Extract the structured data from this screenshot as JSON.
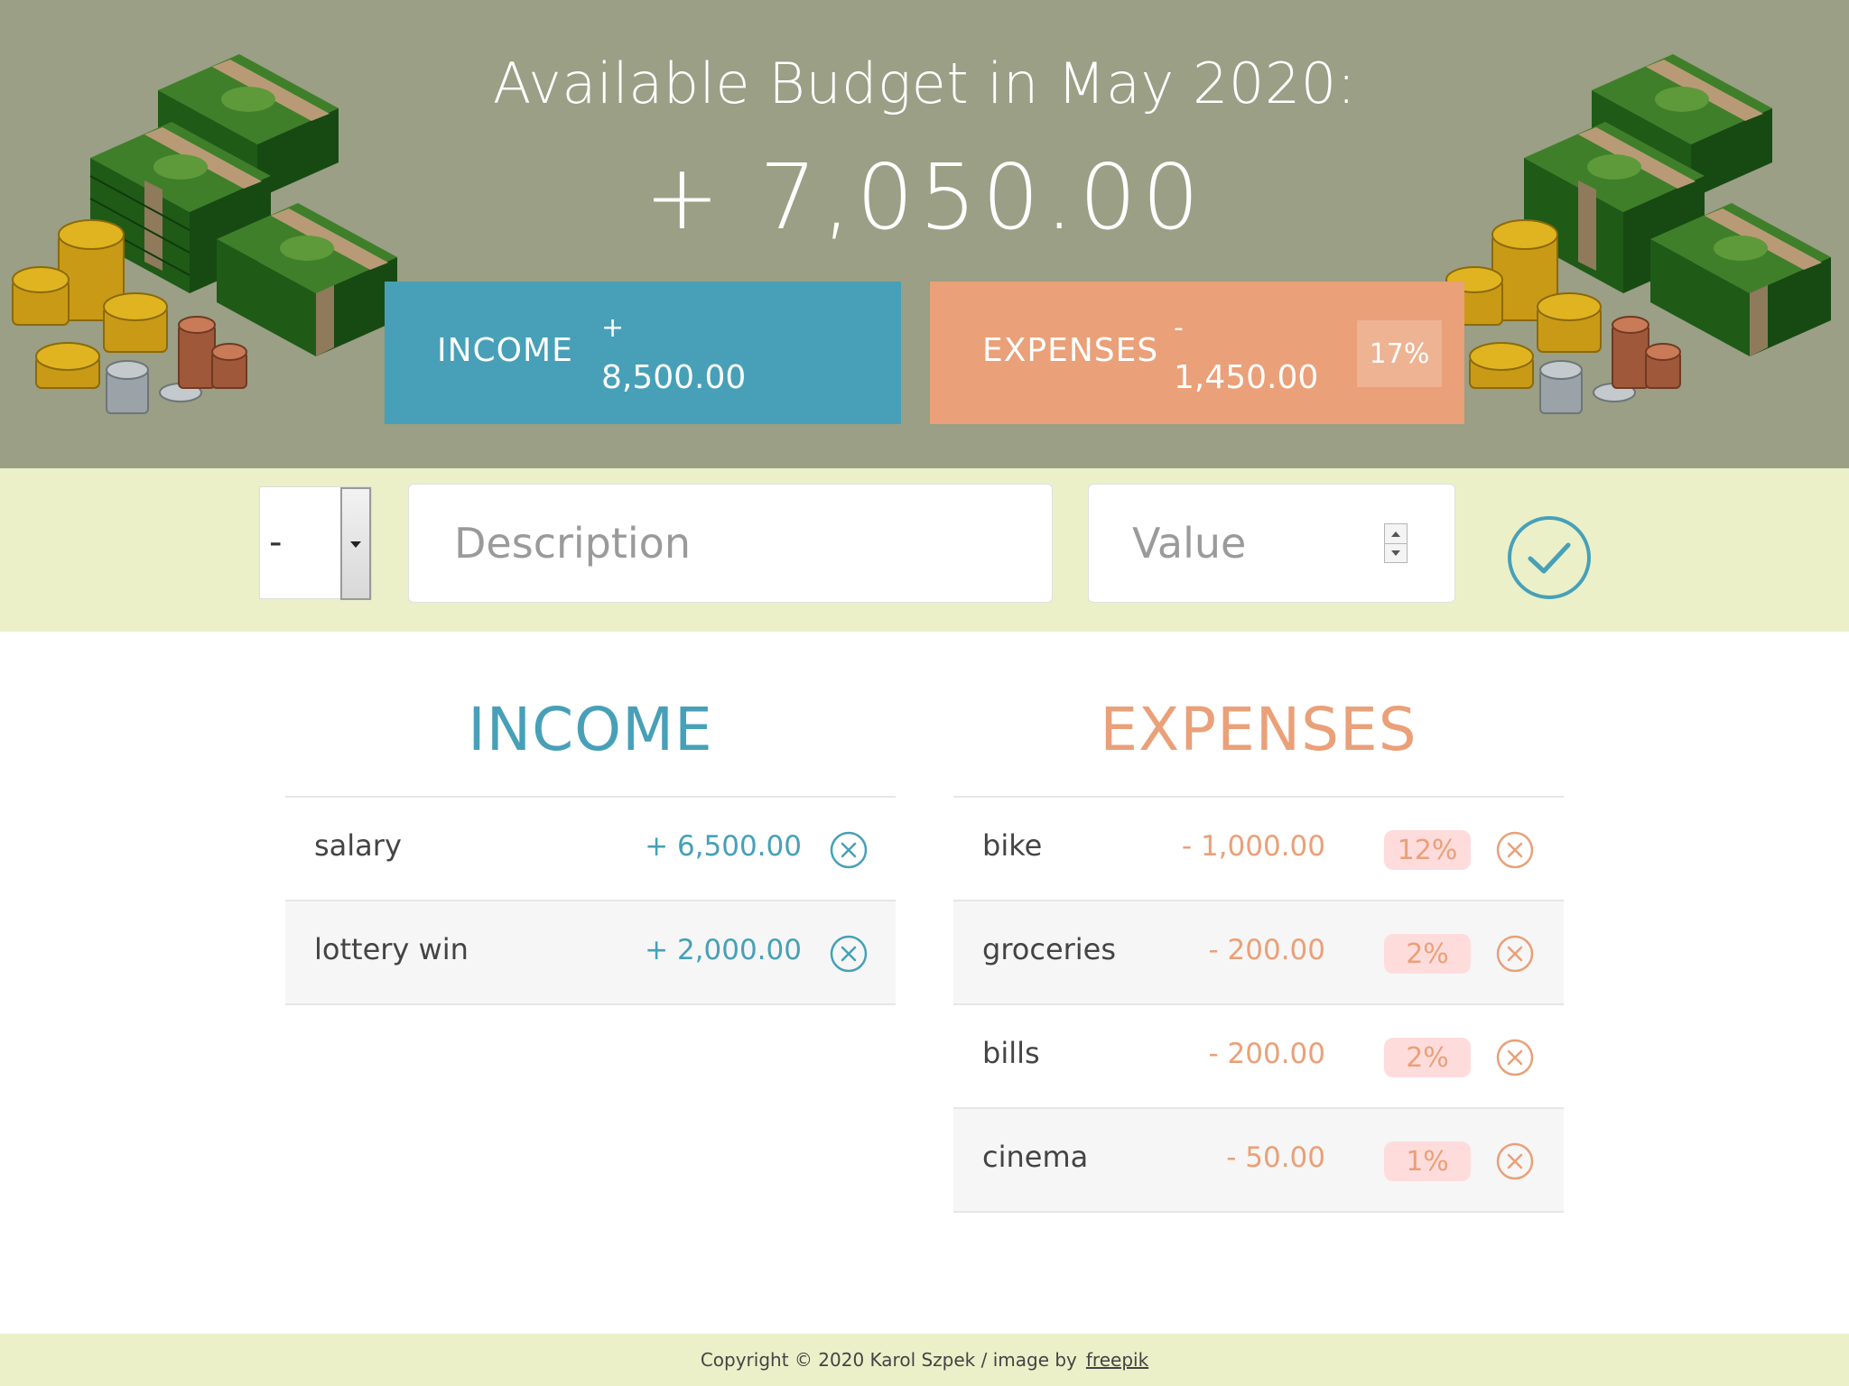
{
  "header": {
    "budget_title": "Available Budget in May 2020:",
    "budget_value": "+ 7,050.00",
    "income_summary": {
      "label": "INCOME",
      "sign": "+",
      "value": "8,500.00"
    },
    "expenses_summary": {
      "label": "EXPENSES",
      "sign": "-",
      "value": "1,450.00",
      "percentage": "17%"
    }
  },
  "add_form": {
    "type_value": "-",
    "description_placeholder": "Description",
    "value_placeholder": "Value"
  },
  "income_list": {
    "title": "INCOME",
    "items": [
      {
        "description": "salary",
        "value": "+ 6,500.00"
      },
      {
        "description": "lottery win",
        "value": "+ 2,000.00"
      }
    ]
  },
  "expenses_list": {
    "title": "EXPENSES",
    "items": [
      {
        "description": "bike",
        "value": "- 1,000.00",
        "percentage": "12%"
      },
      {
        "description": "groceries",
        "value": "- 200.00",
        "percentage": "2%"
      },
      {
        "description": "bills",
        "value": "- 200.00",
        "percentage": "2%"
      },
      {
        "description": "cinema",
        "value": "- 50.00",
        "percentage": "1%"
      }
    ]
  },
  "footer": {
    "text": "Copyright © 2020 Karol Szpek / image by",
    "link": "freepik"
  },
  "colors": {
    "header_bg": "#9a9f85",
    "income": "#47a0b8",
    "expenses": "#eaa078",
    "form_bg": "#ebf0c9",
    "badge_bg": "#ffdcdc"
  }
}
